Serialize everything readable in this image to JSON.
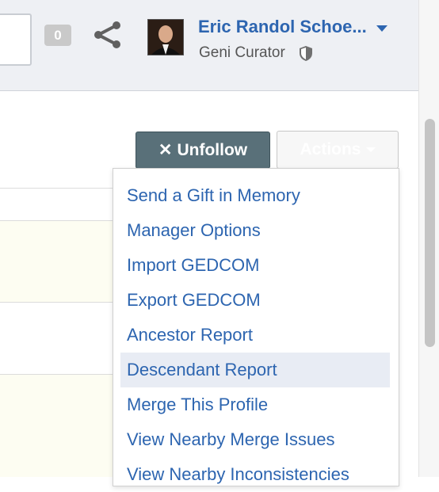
{
  "header": {
    "notification_count": "0",
    "user_name": "Eric Randol Schoe...",
    "user_role": "Geni Curator",
    "icons": [
      "share-icon",
      "shield-icon",
      "chevron-down-icon"
    ]
  },
  "buttons": {
    "unfollow_label": "Unfollow",
    "actions_label": "Actions"
  },
  "menu": {
    "items": [
      "Send a Gift in Memory",
      "Manager Options",
      "Import GEDCOM",
      "Export GEDCOM",
      "Ancestor Report",
      "Descendant Report",
      "Merge This Profile",
      "View Nearby Merge Issues",
      "View Nearby Inconsistencies"
    ],
    "highlighted_index": 5
  },
  "colors": {
    "link": "#2d65b0",
    "unfollow_bg": "#597079",
    "highlight": "#e8ecf4"
  }
}
